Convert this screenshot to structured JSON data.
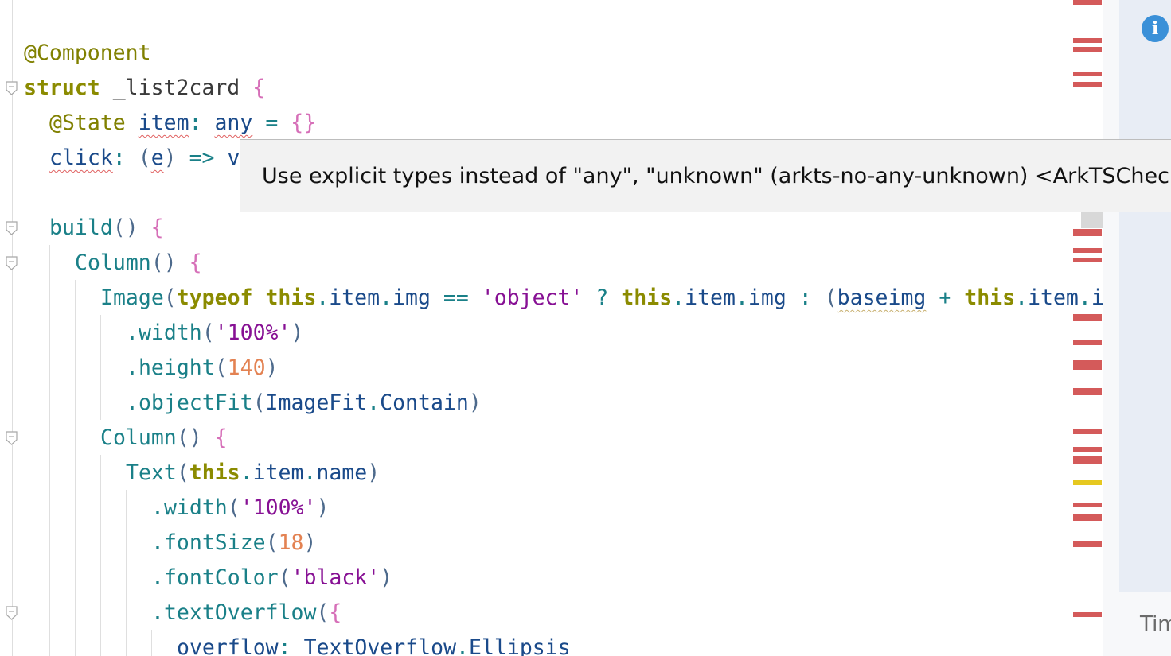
{
  "editor": {
    "lines": {
      "l1": {
        "decorator": "@Component"
      },
      "l2": {
        "kw": "struct",
        "name": "_list2card",
        "brace": "{"
      },
      "l3": {
        "decorator": "@State",
        "field": "item",
        "colon": ":",
        "type": "any",
        "eq": "=",
        "init": "{}"
      },
      "l4": {
        "field": "click",
        "colon": ":",
        "open": "(",
        "param": "e",
        "close": ")",
        "arrow": "=>",
        "rest": "v"
      },
      "l6": {
        "fn": "build",
        "parens": "()",
        "brace": "{"
      },
      "l7": {
        "fn": "Column",
        "parens": "()",
        "brace": "{"
      },
      "l8": {
        "fn": "Image",
        "open": "(",
        "kw1": "typeof",
        "this1": "this",
        "d1": ".",
        "p1": "item",
        "d2": ".",
        "p2": "img",
        "eqeq": "==",
        "str": "'object'",
        "q": "?",
        "this2": "this",
        "d3": ".",
        "p3": "item",
        "d4": ".",
        "p4": "img",
        "colon": ":",
        "open2": "(",
        "ref": "baseimg",
        "plus": "+",
        "this3": "this",
        "d5": ".",
        "p5": "item",
        "d6": ".",
        "p6": "i"
      },
      "l9": {
        "dot": ".",
        "method": "width",
        "open": "(",
        "arg": "'100%'",
        "close": ")"
      },
      "l10": {
        "dot": ".",
        "method": "height",
        "open": "(",
        "arg": "140",
        "close": ")"
      },
      "l11": {
        "dot": ".",
        "method": "objectFit",
        "open": "(",
        "ref1": "ImageFit",
        "dot2": ".",
        "ref2": "Contain",
        "close": ")"
      },
      "l12": {
        "fn": "Column",
        "parens": "()",
        "brace": "{"
      },
      "l13": {
        "fn": "Text",
        "open": "(",
        "this": "this",
        "d1": ".",
        "p1": "item",
        "d2": ".",
        "p2": "name",
        "close": ")"
      },
      "l14": {
        "dot": ".",
        "method": "width",
        "open": "(",
        "arg": "'100%'",
        "close": ")"
      },
      "l15": {
        "dot": ".",
        "method": "fontSize",
        "open": "(",
        "arg": "18",
        "close": ")"
      },
      "l16": {
        "dot": ".",
        "method": "fontColor",
        "open": "(",
        "arg": "'black'",
        "close": ")"
      },
      "l17": {
        "dot": ".",
        "method": "textOverflow",
        "open": "(",
        "brace": "{"
      },
      "l18": {
        "key": "overflow",
        "colon": ":",
        "ref1": "TextOverflow",
        "dot": ".",
        "ref2": "Ellipsis"
      }
    }
  },
  "tooltip": {
    "text": "Use explicit types instead of \"any\", \"unknown\" (arkts-no-any-unknown) <ArkTSCheck>"
  },
  "sidepanel": {
    "tab_label": "Tim"
  },
  "icons": {
    "info": "info-icon",
    "fold": "fold-marker-icon"
  },
  "colors": {
    "error_marker": "#d45a5a",
    "warning_marker": "#e6c820",
    "info_icon": "#3a90d8"
  }
}
